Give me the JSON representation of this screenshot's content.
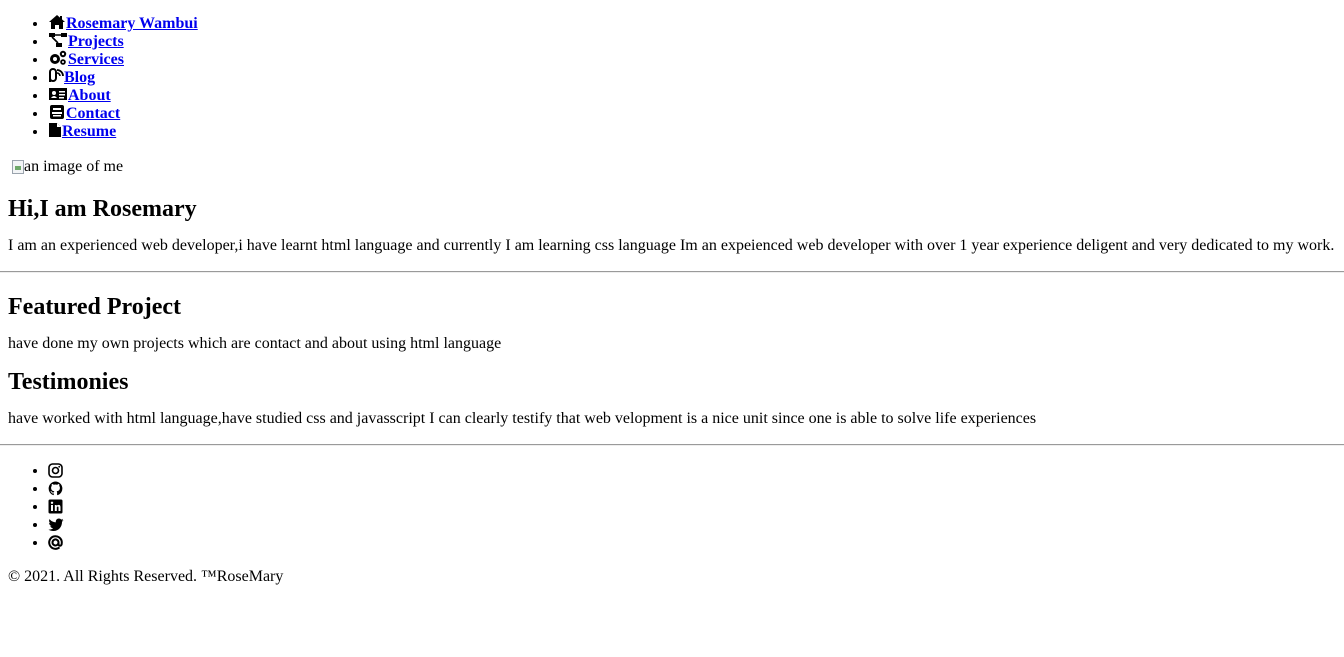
{
  "nav": {
    "items": [
      {
        "label": "Rosemary Wambui",
        "icon": "home-icon"
      },
      {
        "label": "Projects",
        "icon": "project-diagram-icon"
      },
      {
        "label": "Services",
        "icon": "cogs-icon"
      },
      {
        "label": "Blog",
        "icon": "blog-icon"
      },
      {
        "label": "About",
        "icon": "id-card-icon"
      },
      {
        "label": "Contact",
        "icon": "contact-icon"
      },
      {
        "label": "Resume",
        "icon": "file-icon"
      }
    ]
  },
  "hero": {
    "image_alt": "an image of me",
    "heading": "Hi,I am Rosemary",
    "intro": "I am an experienced web developer,i have learnt html language and currently I am learning css language Im an expeienced web developer with over 1 year experience deligent and very dedicated to my work."
  },
  "featured": {
    "heading": "Featured Project",
    "text": "have done my own projects which are contact and about using html language"
  },
  "testimonies": {
    "heading": "Testimonies",
    "text": "have worked with html language,have studied css and javasscript I can clearly testify that web velopment is a nice unit since one is able to solve life experiences"
  },
  "social": {
    "icons": [
      "instagram-icon",
      "github-icon",
      "linkedin-icon",
      "twitter-icon",
      "at-icon"
    ]
  },
  "footer": {
    "text": "© 2021. All Rights Reserved. ™RoseMary"
  }
}
